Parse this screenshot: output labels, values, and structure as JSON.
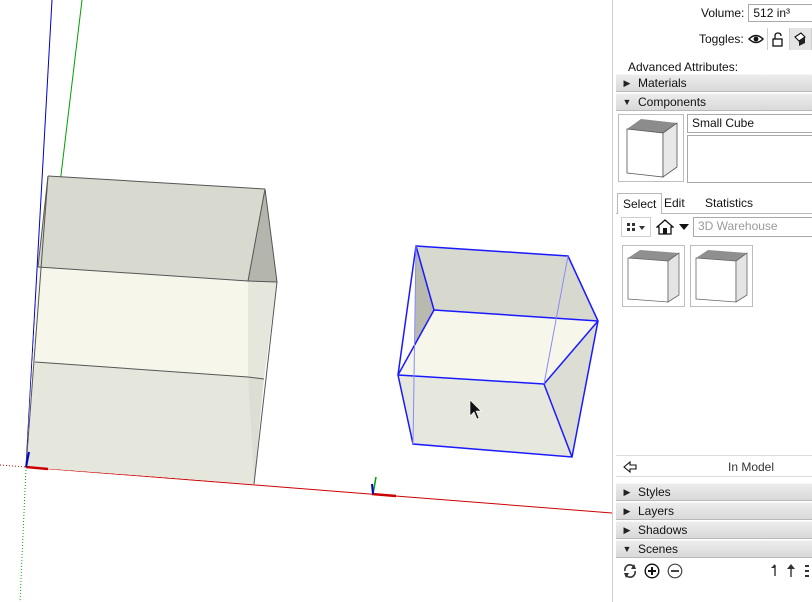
{
  "entity_info": {
    "volume_label": "Volume:",
    "volume_value": "512 in³",
    "toggles_label": "Toggles:",
    "advanced_label": "Advanced Attributes:"
  },
  "sections": {
    "materials": "Materials",
    "components": "Components",
    "styles": "Styles",
    "layers": "Layers",
    "shadows": "Shadows",
    "scenes": "Scenes"
  },
  "components": {
    "name_value": "Small Cube",
    "description_value": "",
    "tabs": [
      "Select",
      "Edit",
      "Statistics"
    ],
    "active_tab": "Select",
    "search_placeholder": "3D Warehouse",
    "in_model_label": "In Model"
  },
  "colors": {
    "selection": "#1a1aff",
    "axis_red": "#cc0000",
    "axis_green": "#00a000",
    "axis_blue": "#0000cc",
    "face_front": "#f6f7ea",
    "face_side": "#d7d8ce"
  },
  "icons": {
    "toggles": [
      "eye-icon",
      "lock-icon",
      "cast-shadow-icon"
    ],
    "components_toolbar": [
      "view-options-icon",
      "home-icon",
      "dropdown-arrow-icon"
    ],
    "scenes_toolbar": [
      "update-scene-icon",
      "add-scene-icon",
      "remove-scene-icon",
      "move-scene-down-icon",
      "move-scene-up-icon",
      "scene-options-icon"
    ],
    "cursor": "select-arrow-cursor"
  }
}
